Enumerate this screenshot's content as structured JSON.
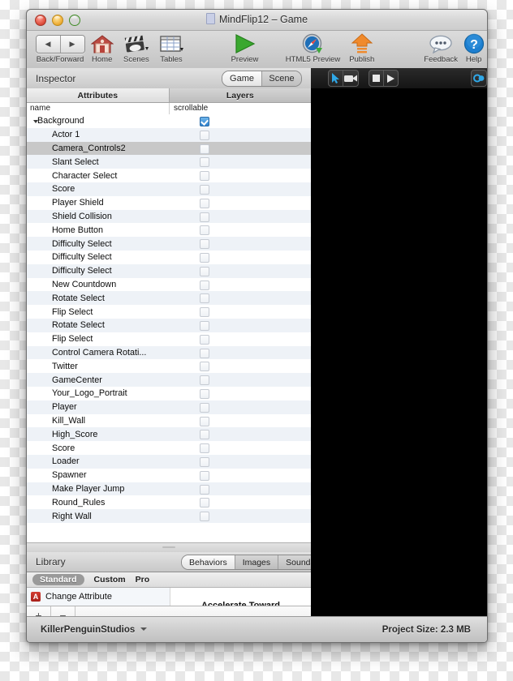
{
  "window": {
    "title": "MindFlip12 – Game",
    "controls": [
      "close",
      "minimize",
      "zoom"
    ]
  },
  "toolbar": {
    "items": [
      {
        "label": "Back/Forward",
        "icon": "back-forward-segmented-icon"
      },
      {
        "label": "Home",
        "icon": "home-icon"
      },
      {
        "label": "Scenes",
        "icon": "clapperboard-icon"
      },
      {
        "label": "Tables",
        "icon": "table-grid-icon"
      },
      {
        "label": "Preview",
        "icon": "play-triangle-icon"
      },
      {
        "label": "HTML5 Preview",
        "icon": "compass-safari-icon"
      },
      {
        "label": "Publish",
        "icon": "orange-up-arrow-icon"
      },
      {
        "label": "Feedback",
        "icon": "speech-bubble-icon"
      },
      {
        "label": "Help",
        "icon": "question-mark-circle-icon"
      }
    ]
  },
  "inspector": {
    "title": "Inspector",
    "mode_segments": [
      {
        "label": "Game",
        "selected": true
      },
      {
        "label": "Scene",
        "selected": false
      }
    ],
    "tabs": [
      {
        "label": "Attributes",
        "selected": true
      },
      {
        "label": "Layers",
        "selected": false
      }
    ],
    "columns": [
      "name",
      "scrollable"
    ],
    "rows": [
      {
        "name": "Background",
        "scrollable": true,
        "root": true,
        "expanded": true,
        "selected": false
      },
      {
        "name": "Actor 1",
        "scrollable": false,
        "root": false,
        "selected": false
      },
      {
        "name": "Camera_Controls2",
        "scrollable": false,
        "root": false,
        "selected": true
      },
      {
        "name": "Slant Select",
        "scrollable": false,
        "root": false,
        "selected": false
      },
      {
        "name": "Character Select",
        "scrollable": false,
        "root": false,
        "selected": false
      },
      {
        "name": "Score",
        "scrollable": false,
        "root": false,
        "selected": false
      },
      {
        "name": "Player Shield",
        "scrollable": false,
        "root": false,
        "selected": false
      },
      {
        "name": "Shield Collision",
        "scrollable": false,
        "root": false,
        "selected": false
      },
      {
        "name": "Home Button",
        "scrollable": false,
        "root": false,
        "selected": false
      },
      {
        "name": "Difficulty Select",
        "scrollable": false,
        "root": false,
        "selected": false
      },
      {
        "name": "Difficulty Select",
        "scrollable": false,
        "root": false,
        "selected": false
      },
      {
        "name": "Difficulty Select",
        "scrollable": false,
        "root": false,
        "selected": false
      },
      {
        "name": "New Countdown",
        "scrollable": false,
        "root": false,
        "selected": false
      },
      {
        "name": "Rotate Select",
        "scrollable": false,
        "root": false,
        "selected": false
      },
      {
        "name": "Flip Select",
        "scrollable": false,
        "root": false,
        "selected": false
      },
      {
        "name": "Rotate Select",
        "scrollable": false,
        "root": false,
        "selected": false
      },
      {
        "name": "Flip Select",
        "scrollable": false,
        "root": false,
        "selected": false
      },
      {
        "name": "Control Camera Rotati...",
        "scrollable": false,
        "root": false,
        "selected": false
      },
      {
        "name": "Twitter",
        "scrollable": false,
        "root": false,
        "selected": false
      },
      {
        "name": "GameCenter",
        "scrollable": false,
        "root": false,
        "selected": false
      },
      {
        "name": "Your_Logo_Portrait",
        "scrollable": false,
        "root": false,
        "selected": false
      },
      {
        "name": "Player",
        "scrollable": false,
        "root": false,
        "selected": false
      },
      {
        "name": "Kill_Wall",
        "scrollable": false,
        "root": false,
        "selected": false
      },
      {
        "name": "High_Score",
        "scrollable": false,
        "root": false,
        "selected": false
      },
      {
        "name": "Score",
        "scrollable": false,
        "root": false,
        "selected": false
      },
      {
        "name": "Loader",
        "scrollable": false,
        "root": false,
        "selected": false
      },
      {
        "name": "Spawner",
        "scrollable": false,
        "root": false,
        "selected": false
      },
      {
        "name": "Make Player Jump",
        "scrollable": false,
        "root": false,
        "selected": false
      },
      {
        "name": "Round_Rules",
        "scrollable": false,
        "root": false,
        "selected": false
      },
      {
        "name": "Right Wall",
        "scrollable": false,
        "root": false,
        "selected": false
      }
    ],
    "add_label": "+",
    "remove_label": "−"
  },
  "library": {
    "title": "Library",
    "type_segments": [
      {
        "label": "Behaviors",
        "selected": true
      },
      {
        "label": "Images",
        "selected": false
      },
      {
        "label": "Sounds",
        "selected": false
      }
    ],
    "source_tabs": [
      {
        "label": "Standard",
        "selected": true
      },
      {
        "label": "Custom",
        "selected": false
      },
      {
        "label": "Pro",
        "selected": false
      }
    ],
    "items": [
      {
        "label": "Change Attribute",
        "icon": "attribute-a-icon",
        "badge": "A"
      }
    ],
    "detail_clipped_text": "Accelerate Toward",
    "add_label": "+",
    "remove_label": "−"
  },
  "preview_controls": {
    "group1": [
      {
        "icon": "pointer-arrow-icon"
      },
      {
        "icon": "video-camera-icon"
      }
    ],
    "group2": [
      {
        "icon": "stop-square-icon"
      },
      {
        "icon": "play-triangle-icon"
      }
    ],
    "group3": [
      {
        "icon": "link-chain-icon"
      }
    ]
  },
  "status": {
    "account": "KillerPenguinStudios",
    "project_size": "Project Size: 2.3 MB"
  },
  "colors": {
    "accent_blue": "#2f82cf",
    "publish_orange": "#f08a2c",
    "selection_gray": "#c8c8c8",
    "row_alt": "#eef2f7",
    "canvas_black": "#000000",
    "badge_red": "#c0281f"
  }
}
